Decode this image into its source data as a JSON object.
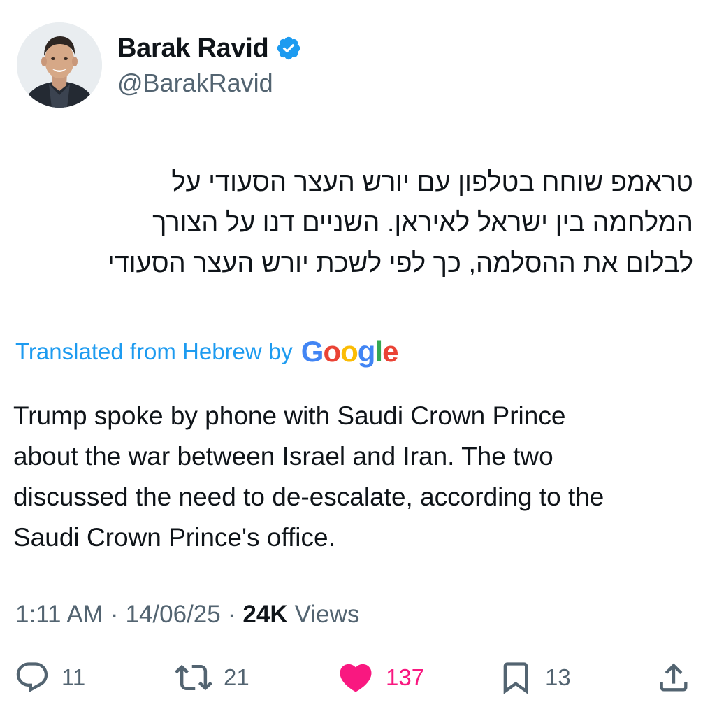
{
  "author": {
    "display_name": "Barak Ravid",
    "handle": "@BarakRavid",
    "verified_icon": "verified-badge-icon",
    "avatar_icon": "avatar-photo"
  },
  "tweet": {
    "original_text": "טראמפ שוחח בטלפון עם יורש העצר הסעודי על\nהמלחמה בין ישראל לאיראן. השניים דנו על  הצורך\nלבלום את ההסלמה, כך לפי לשכת יורש העצר הסעודי",
    "translated_label": "Translated from Hebrew by",
    "translation_provider": {
      "letters": [
        "G",
        "o",
        "o",
        "g",
        "l",
        "e"
      ],
      "colors": [
        "#4285f4",
        "#ea4335",
        "#fbbc05",
        "#4285f4",
        "#34a853",
        "#ea4335"
      ]
    },
    "translated_text": "Trump spoke by phone with Saudi Crown Prince\nabout the war between Israel and Iran. The two\ndiscussed the need to de-escalate, according to the\nSaudi Crown Prince's office."
  },
  "meta": {
    "time": "1:11 AM",
    "separator": "·",
    "date": "14/06/25",
    "views_count": "24K",
    "views_label": "Views"
  },
  "actions": {
    "replies": {
      "icon": "reply-icon",
      "count": "11"
    },
    "retweets": {
      "icon": "retweet-icon",
      "count": "21"
    },
    "likes": {
      "icon": "heart-icon",
      "count": "137",
      "liked": true
    },
    "bookmarks": {
      "icon": "bookmark-icon",
      "count": "13"
    },
    "share": {
      "icon": "share-icon"
    }
  },
  "colors": {
    "link_blue": "#1d9bf0",
    "secondary_gray": "#536471",
    "like_pink": "#f91880",
    "text": "#0f1419"
  }
}
